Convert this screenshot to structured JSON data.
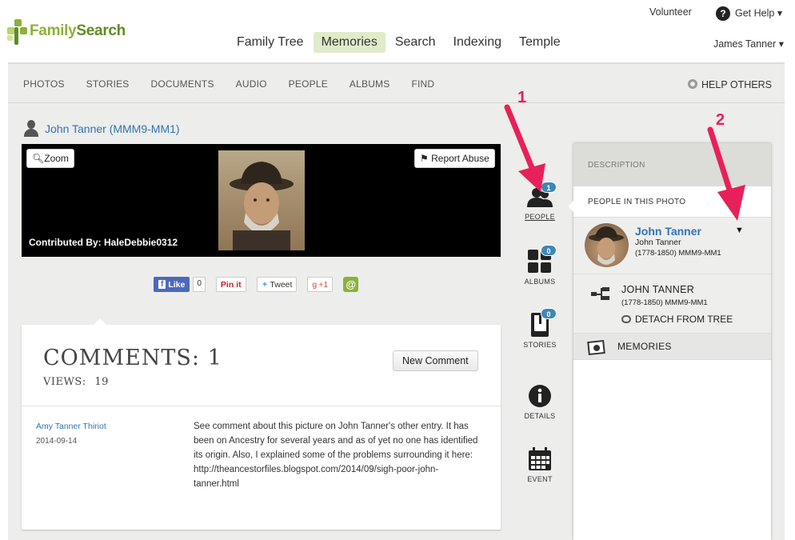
{
  "header": {
    "logo_text_1": "Family",
    "logo_text_2": "Search",
    "nav": [
      "Family Tree",
      "Memories",
      "Search",
      "Indexing",
      "Temple"
    ],
    "active_nav": "Memories",
    "volunteer": "Volunteer",
    "get_help": "Get Help",
    "get_help_caret": "▾",
    "user": "James Tanner",
    "user_caret": "▾"
  },
  "subnav": {
    "items": [
      "PHOTOS",
      "STORIES",
      "DOCUMENTS",
      "AUDIO",
      "PEOPLE",
      "ALBUMS",
      "FIND"
    ],
    "help_others": "HELP OTHERS"
  },
  "photo": {
    "title": "John Tanner (MMM9-MM1)",
    "zoom": "Zoom",
    "report": "Report Abuse",
    "contributed_label": "Contributed By:",
    "contributor": "HaleDebbie0312"
  },
  "social": {
    "like": "Like",
    "like_count": "0",
    "pinit": "Pin it",
    "tweet": "Tweet",
    "gplus": "+1",
    "at": "@"
  },
  "comments": {
    "title": "COMMENTS:",
    "count": "1",
    "views_label": "VIEWS:",
    "views": "19",
    "new_button": "New Comment",
    "items": [
      {
        "author": "Amy Tanner Thiriot",
        "date": "2014-09-14",
        "text": "See comment about this picture on John Tanner's other entry. It has been on Ancestry for several years and as of yet no one has identified its origin. Also, I explained some of the problems surrounding it here: http://theancestorfiles.blogspot.com/2014/09/sigh-poor-john-tanner.html"
      }
    ]
  },
  "toolbar": [
    {
      "label": "PEOPLE",
      "badge": "1",
      "icon": "people-icon"
    },
    {
      "label": "ALBUMS",
      "badge": "0",
      "icon": "albums-icon"
    },
    {
      "label": "STORIES",
      "badge": "0",
      "icon": "stories-icon"
    },
    {
      "label": "DETAILS",
      "badge": "",
      "icon": "info-icon"
    },
    {
      "label": "EVENT",
      "badge": "",
      "icon": "calendar-icon"
    }
  ],
  "panel": {
    "description": "DESCRIPTION",
    "people_in_photo": "PEOPLE IN THIS PHOTO",
    "person_name": "John Tanner",
    "person_sub": "John Tanner",
    "person_dates": "(1778-1850) MMM9-MM1",
    "caret": "▼",
    "tree_name": "JOHN TANNER",
    "tree_dates": "(1778-1850) MMM9-MM1",
    "detach": "DETACH FROM TREE",
    "memories": "MEMORIES"
  },
  "annotations": [
    "1",
    "2"
  ],
  "colors": {
    "brand_green": "#8cb13b",
    "link_blue": "#2f74b5",
    "badge_blue": "#3d88b5",
    "annotation_pink": "#e8205a"
  }
}
